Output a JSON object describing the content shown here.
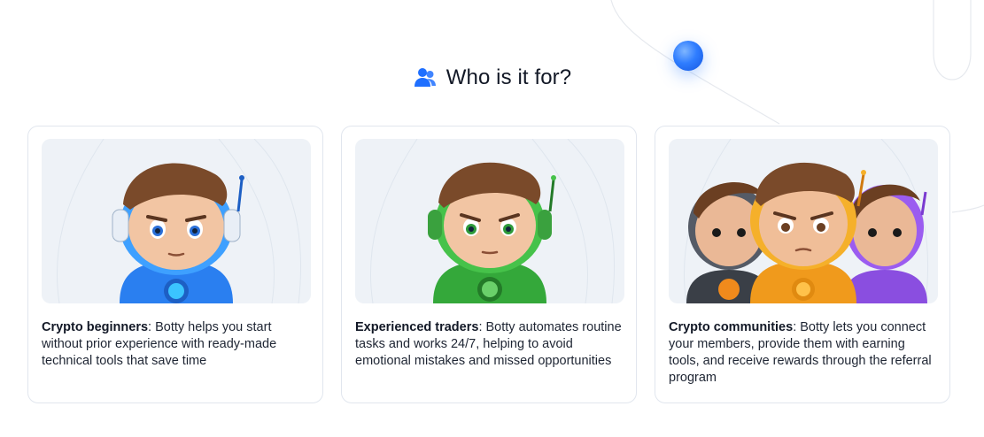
{
  "section": {
    "title": "Who is it for?",
    "icon": "users-icon",
    "accent": "#1f6fff"
  },
  "cards": [
    {
      "title": "Crypto beginners",
      "separator": ":",
      "description": " Botty helps you start without prior experience with ready-made technical tools that save time",
      "image": "blue-robot-boy-illustration",
      "suit_color": "#2a7ff0"
    },
    {
      "title": "Experienced traders",
      "separator": ":",
      "description": " Botty automates routine tasks and works 24/7, helping to avoid emotional mistakes and missed opportunities",
      "image": "green-robot-boy-illustration",
      "suit_color": "#34a83a"
    },
    {
      "title": "Crypto communities",
      "separator": ":",
      "description": " Botty lets you connect your members, provide them with earning tools, and receive rewards through the referral program",
      "image": "group-robot-boys-illustration",
      "suit_color": "#f09a1c"
    }
  ]
}
